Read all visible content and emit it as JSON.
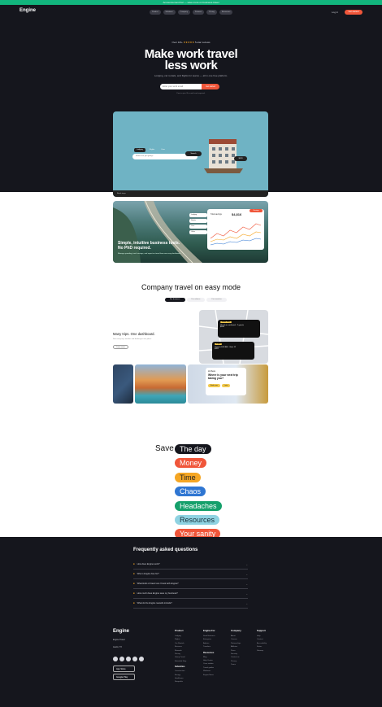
{
  "promo": "Announcement bar — save more on business travel",
  "nav": {
    "logo": "Engine",
    "links": [
      "Product",
      "Solutions",
      "Company",
      "Partners",
      "Pricing",
      "Resources"
    ],
    "login": "Log in",
    "signup": "Get started"
  },
  "hero": {
    "rating_prefix": "Over 1M+",
    "stars": "★★★★★",
    "rating_suffix": "5-star reviews",
    "title_line1": "Make work travel",
    "title_line2": "less work",
    "subtitle": "Lodging, car rentals, and flights for teams — all in one free platform.",
    "email_placeholder": "Enter your work email",
    "cta": "Get started",
    "fine_print": "Free to join. No credit card required."
  },
  "card_stays": {
    "tabs": [
      "Lodging",
      "Flights",
      "Cars"
    ],
    "search_placeholder": "Where are you going?",
    "search_button": "Search",
    "map_pin": "$129",
    "footer": "Book stays"
  },
  "card_insights": {
    "title": "Simple, intuitive business tools. No PhD required.",
    "desc": "Manage spending, track savings, and report on travel from one easy dashboard.",
    "graph_label": "Total savings",
    "graph_value": "$4,816",
    "graph_tag": "Savings",
    "legend": [
      "Lodging",
      "Flights",
      "Cars",
      "Other"
    ],
    "series_colors": [
      "#f0563a",
      "#f5a623",
      "#2f76d2"
    ]
  },
  "company": {
    "title": "Company travel on easy mode",
    "tabs": [
      "For business",
      "For admins",
      "For travelers"
    ],
    "feature_title": "Many trips. One dashboard.",
    "feature_desc": "See every trip, traveler and booking in one place.",
    "feature_button": "Learn more",
    "card1_tag": "Hotel stay",
    "card1_line": "Check-in confirmed · 2 guests",
    "card1_price": "$184",
    "card2_tag": "Flight",
    "card2_line": "Departs 8:45 AM · Gate 12",
    "card2_price": "$312",
    "promo_kicker": "Hi there",
    "promo_title": "Where is your next trip taking you?",
    "promo_buttons": [
      "Book now",
      "Later"
    ]
  },
  "save": {
    "word": "Save",
    "chips": [
      "The day",
      "Money",
      "Time",
      "Chaos",
      "Headaches",
      "Resources",
      "Your sanity"
    ]
  },
  "faq": {
    "title": "Frequently asked questions",
    "items": [
      "How does Engine work?",
      "Who is Engine free for?",
      "What kinds of travel can I book with Engine?",
      "How much does Engine save my business?",
      "What do the Engine rewards include?"
    ]
  },
  "footer": {
    "logo": "Engine",
    "address_line1": "Engine Travel",
    "address_line2": "Austin, TX",
    "app_store": "App Store",
    "google_play": "Google Play",
    "columns": [
      {
        "title": "Product",
        "links": [
          "Lodging",
          "Flights",
          "Car Rentals",
          "Business",
          "Rewards",
          "Pricing",
          "Group Travel",
          "Extended Stay"
        ],
        "subtitle": "Industries",
        "sublinks": [
          "Construction",
          "Energy",
          "Healthcare",
          "Nonprofits"
        ]
      },
      {
        "title": "Engine For",
        "links": [
          "Small business",
          "Enterprise",
          "Admins",
          "Travelers"
        ],
        "subtitle": "Resources",
        "sublinks": [
          "Blog",
          "Help Center",
          "Case studies",
          "Travel guides",
          "Webinars",
          "Engine News"
        ]
      },
      {
        "title": "Company",
        "links": [
          "About",
          "Careers",
          "Partnerships",
          "Affiliates",
          "Press",
          "Security",
          "Contact us",
          "Privacy",
          "Terms"
        ]
      },
      {
        "title": "Support",
        "links": [
          "Help",
          "Contact",
          "Accessibility",
          "Status",
          "Sitemap"
        ]
      }
    ]
  }
}
